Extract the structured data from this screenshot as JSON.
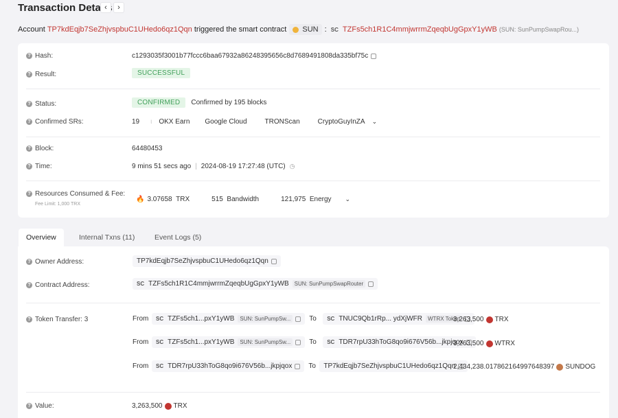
{
  "header": {
    "title": "Transaction Details",
    "prev": "‹",
    "next": "›"
  },
  "trigger": {
    "prefix": "Account",
    "account": "TP7kdEqjb7SeZhjvspbuC1UHedo6qz1Qqn",
    "middle": "triggered the smart contract",
    "contract_token": "SUN",
    "colon": ":",
    "sc": "SC",
    "contract_address": "TZFs5ch1R1C4mmjwrrmZqeqbUgGpxY1yWB",
    "contract_name": "(SUN: SunPumpSwapRou...)"
  },
  "details": {
    "hash_label": "Hash:",
    "hash": "c1293035f3001b77fccc6baa67932a86248395656c8d7689491808da335bf75c",
    "result_label": "Result:",
    "result": "SUCCESSFUL",
    "status_label": "Status:",
    "status": "CONFIRMED",
    "confirmed_by": "Confirmed by 195 blocks",
    "srs_label": "Confirmed SRs:",
    "srs_count": "19",
    "srs": [
      "OKX Earn",
      "Google Cloud",
      "TRONScan",
      "CryptoGuyInZA"
    ],
    "block_label": "Block:",
    "block": "64480453",
    "time_label": "Time:",
    "time_ago": "9 mins 51 secs ago",
    "time_divider": "|",
    "time_full": "2024-08-19 17:27:48 (UTC)",
    "resources_label": "Resources Consumed & Fee:",
    "fee_limit": "Fee Limit: 1,000 TRX",
    "trx_amount": "3.07658",
    "trx_unit": "TRX",
    "bandwidth_amount": "515",
    "bandwidth_unit": "Bandwidth",
    "energy_amount": "121,975",
    "energy_unit": "Energy"
  },
  "tabs": [
    {
      "label": "Overview",
      "active": true
    },
    {
      "label": "Internal Txns (11)",
      "active": false
    },
    {
      "label": "Event Logs (5)",
      "active": false
    }
  ],
  "overview": {
    "owner_label": "Owner Address:",
    "owner": "TP7kdEqjb7SeZhjvspbuC1UHedo6qz1Qqn",
    "contract_label": "Contract Address:",
    "contract_sc": "SC",
    "contract": "TZFs5ch1R1C4mmjwrrmZqeqbUgGpxY1yWB",
    "contract_tag": "SUN: SunPumpSwapRouter",
    "transfer_label": "Token Transfer:",
    "transfer_count": "3",
    "transfers": [
      {
        "from_label": "From",
        "from_sc": "SC",
        "from": "TZFs5ch1...pxY1yWB",
        "from_tag": "SUN: SunPumpSw...",
        "to_label": "To",
        "to_sc": "SC",
        "to": "TNUC9Qb1rRp... ydXjWFR",
        "to_tag": "WTRX Token",
        "amount": "3,263,500",
        "token": "TRX"
      },
      {
        "from_label": "From",
        "from_sc": "SC",
        "from": "TZFs5ch1...pxY1yWB",
        "from_tag": "SUN: SunPumpSw...",
        "to_label": "To",
        "to_sc": "SC",
        "to": "TDR7rpU33hToG8qo9i676V56b...jkpjqox",
        "to_tag": "",
        "amount": "3,263,500",
        "token": "WTRX"
      },
      {
        "from_label": "From",
        "from_sc": "SC",
        "from": "TDR7rpU33hToG8qo9i676V56b...jkpjqox",
        "from_tag": "",
        "to_label": "To",
        "to_sc": "",
        "to": "TP7kdEqjb7SeZhjvspbuC1UHedo6qz1Qqn",
        "to_tag": "",
        "amount": "2,434,238.017862164997648397",
        "token": "SUNDOG"
      }
    ],
    "value_label": "Value:",
    "value": "3,263,500",
    "value_unit": "TRX"
  },
  "colors": {
    "accent_red": "#c23631",
    "success_green": "#41a05a",
    "background": "#f3f3f6"
  }
}
